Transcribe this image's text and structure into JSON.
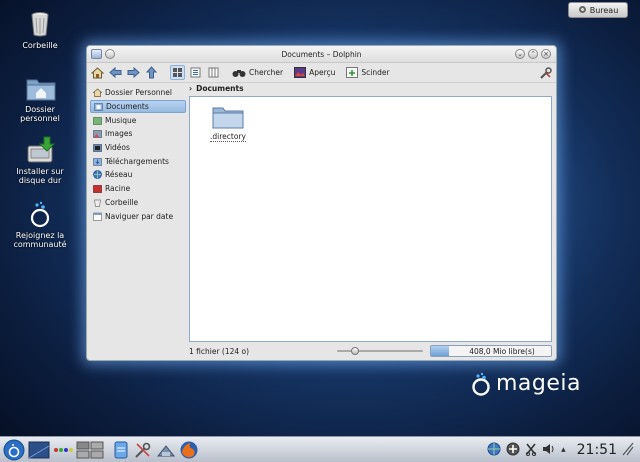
{
  "desktop": {
    "bureau_button": "Bureau",
    "icons": [
      {
        "label": "Corbeille",
        "icon": "trash-icon"
      },
      {
        "label": "Dossier personnel",
        "icon": "home-folder-icon"
      },
      {
        "label": "Installer sur disque dur",
        "icon": "install-icon"
      },
      {
        "label": "Rejoignez la communauté",
        "icon": "mageia-community-icon"
      }
    ]
  },
  "window": {
    "title": "Documents – Dolphin",
    "toolbar": {
      "search": "Chercher",
      "preview": "Aperçu",
      "split": "Scinder"
    },
    "sidebar": [
      {
        "label": "Dossier Personnel",
        "icon": "home-icon",
        "selected": false
      },
      {
        "label": "Documents",
        "icon": "documents-folder-icon",
        "selected": true
      },
      {
        "label": "Musique",
        "icon": "music-folder-icon",
        "selected": false
      },
      {
        "label": "Images",
        "icon": "images-folder-icon",
        "selected": false
      },
      {
        "label": "Vidéos",
        "icon": "videos-folder-icon",
        "selected": false
      },
      {
        "label": "Téléchargements",
        "icon": "downloads-folder-icon",
        "selected": false
      },
      {
        "label": "Réseau",
        "icon": "network-icon",
        "selected": false
      },
      {
        "label": "Racine",
        "icon": "root-folder-icon",
        "selected": false
      },
      {
        "label": "Corbeille",
        "icon": "trash-icon",
        "selected": false
      },
      {
        "label": "Naviguer par date",
        "icon": "calendar-icon",
        "selected": false
      }
    ],
    "breadcrumb": "Documents",
    "files": [
      {
        "name": ".directory",
        "icon": "folder-icon"
      }
    ],
    "status": {
      "summary": "1 fichier (124 o)",
      "free_space": "408,0 Mio libre(s)",
      "free_space_fill": 0.15
    }
  },
  "branding": {
    "logo_text": "mageia"
  },
  "panel": {
    "clock": "21:51"
  },
  "colors": {
    "selection": "#96badf",
    "window_glow": "#78b4ff",
    "desktop_bg": "#17386a"
  }
}
